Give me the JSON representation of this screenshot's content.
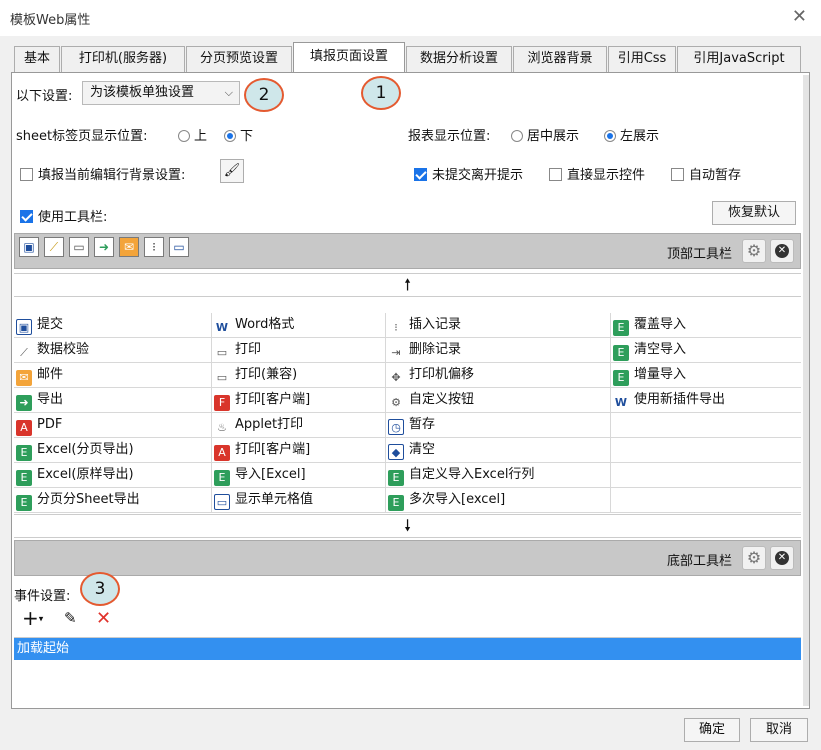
{
  "window": {
    "title": "模板Web属性",
    "close_glyph": "✕"
  },
  "tabs": [
    {
      "label": "基本"
    },
    {
      "label": "打印机(服务器)"
    },
    {
      "label": "分页预览设置"
    },
    {
      "label": "填报页面设置",
      "active": true
    },
    {
      "label": "数据分析设置"
    },
    {
      "label": "浏览器背景"
    },
    {
      "label": "引用Css"
    },
    {
      "label": "引用JavaScript"
    }
  ],
  "settings": {
    "label": "以下设置:",
    "select_value": "为该模板单独设置",
    "sheet_pos_label": "sheet标签页显示位置:",
    "sheet_pos_top": "上",
    "sheet_pos_bottom": "下",
    "report_pos_label": "报表显示位置:",
    "report_center": "居中展示",
    "report_left": "左展示",
    "row_bg_label": "填报当前编辑行背景设置:",
    "unsubmitted_prompt": "未提交离开提示",
    "show_controls": "直接显示控件",
    "auto_save": "自动暂存",
    "use_toolbar": "使用工具栏:",
    "restore_default": "恢复默认"
  },
  "callouts": [
    "1",
    "2",
    "3"
  ],
  "top_toolbar": {
    "label": "顶部工具栏",
    "icons": [
      "save-icon",
      "check-wand-icon",
      "printer-icon",
      "export-icon",
      "mail-icon",
      "insert-row-icon",
      "cell-value-icon"
    ]
  },
  "bottom_toolbar": {
    "label": "底部工具栏"
  },
  "arrows": {
    "up": "🠕",
    "down": "🠗"
  },
  "buttons_grid": [
    [
      {
        "icon": "save-icon",
        "label": "提交"
      },
      {
        "icon": "word-icon",
        "label": "Word格式"
      },
      {
        "icon": "insert-row-icon",
        "label": "插入记录"
      },
      {
        "icon": "excel-icon",
        "label": "覆盖导入"
      }
    ],
    [
      {
        "icon": "check-wand-icon",
        "label": "数据校验"
      },
      {
        "icon": "printer-icon",
        "label": "打印"
      },
      {
        "icon": "delete-row-icon",
        "label": "删除记录"
      },
      {
        "icon": "excel-icon",
        "label": "清空导入"
      }
    ],
    [
      {
        "icon": "mail-icon",
        "label": "邮件"
      },
      {
        "icon": "printer-icon",
        "label": "打印(兼容)"
      },
      {
        "icon": "move-icon",
        "label": "打印机偏移"
      },
      {
        "icon": "excel-icon",
        "label": "增量导入"
      }
    ],
    [
      {
        "icon": "export-icon",
        "label": "导出"
      },
      {
        "icon": "flash-print-icon",
        "label": "打印[客户端]"
      },
      {
        "icon": "gear-icon",
        "label": "自定义按钮"
      },
      {
        "icon": "word-icon",
        "label": "使用新插件导出"
      }
    ],
    [
      {
        "icon": "pdf-icon",
        "label": "PDF"
      },
      {
        "icon": "applet-icon",
        "label": "Applet打印"
      },
      {
        "icon": "temp-save-icon",
        "label": "暂存"
      },
      {
        "icon": "",
        "label": ""
      }
    ],
    [
      {
        "icon": "excel-icon",
        "label": "Excel(分页导出)"
      },
      {
        "icon": "pdf-icon",
        "label": "打印[客户端]"
      },
      {
        "icon": "eraser-icon",
        "label": "清空"
      },
      {
        "icon": "",
        "label": ""
      }
    ],
    [
      {
        "icon": "excel-icon",
        "label": "Excel(原样导出)"
      },
      {
        "icon": "excel-icon",
        "label": "导入[Excel]"
      },
      {
        "icon": "excel-icon",
        "label": "自定义导入Excel行列"
      },
      {
        "icon": "",
        "label": ""
      }
    ],
    [
      {
        "icon": "excel-icon",
        "label": "分页分Sheet导出"
      },
      {
        "icon": "cell-value-icon",
        "label": "显示单元格值"
      },
      {
        "icon": "excel-icon",
        "label": "多次导入[excel]"
      },
      {
        "icon": "",
        "label": ""
      }
    ]
  ],
  "events": {
    "label": "事件设置:",
    "items": [
      "加载起始"
    ]
  },
  "footer": {
    "ok": "确定",
    "cancel": "取消"
  },
  "colors": {
    "accent": "#1a73e8",
    "selection": "#3390f0",
    "callout_border": "#e45a30",
    "callout_fill": "#cfe7ea"
  }
}
